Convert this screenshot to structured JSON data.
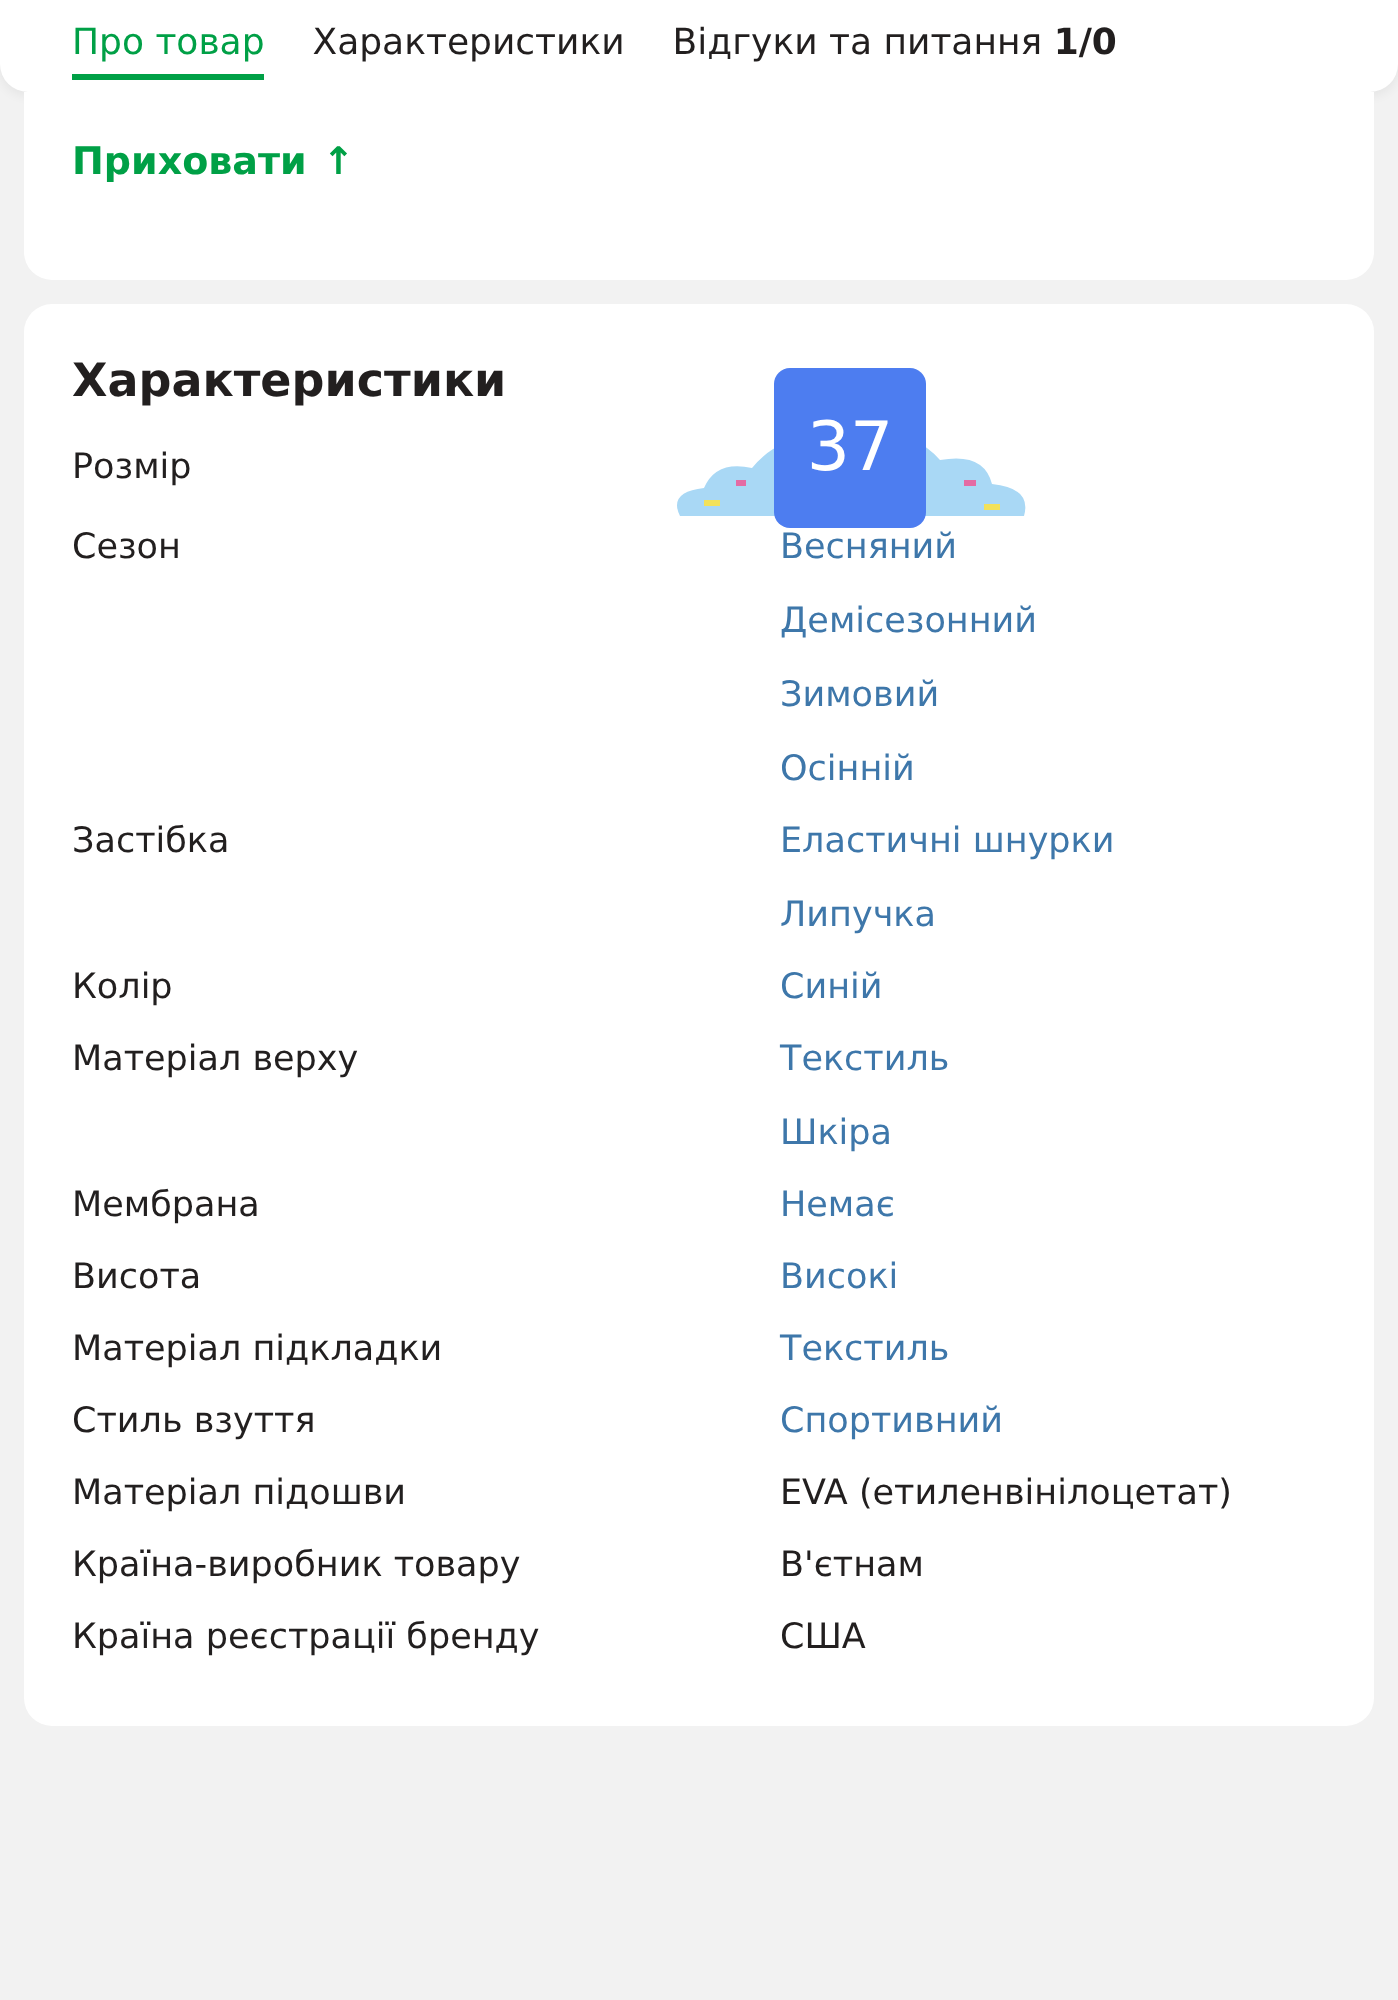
{
  "tabs": [
    {
      "label": "Про товар",
      "selected": true
    },
    {
      "label": "Характеристики",
      "selected": false
    },
    {
      "label": "Відгуки та питання",
      "count": "1/0",
      "selected": false
    }
  ],
  "hide_link": {
    "label": "Приховати",
    "icon": "↑"
  },
  "characteristics": {
    "title": "Характеристики",
    "rows": [
      {
        "label": "Розмір",
        "values": [
          {
            "text": "37",
            "kind": "badge"
          }
        ]
      },
      {
        "label": "Сезон",
        "values": [
          {
            "text": "Весняний",
            "kind": "link"
          },
          {
            "text": "Демісезонний",
            "kind": "link"
          },
          {
            "text": "Зимовий",
            "kind": "link"
          },
          {
            "text": "Осінній",
            "kind": "link"
          }
        ]
      },
      {
        "label": "Застібка",
        "values": [
          {
            "text": "Еластичні шнурки",
            "kind": "link"
          },
          {
            "text": "Липучка",
            "kind": "link"
          }
        ]
      },
      {
        "label": "Колір",
        "values": [
          {
            "text": "Синій",
            "kind": "link"
          }
        ]
      },
      {
        "label": "Матеріал верху",
        "values": [
          {
            "text": "Текстиль",
            "kind": "link"
          },
          {
            "text": "Шкіра",
            "kind": "link"
          }
        ]
      },
      {
        "label": "Мембрана",
        "values": [
          {
            "text": "Немає",
            "kind": "link"
          }
        ]
      },
      {
        "label": "Висота",
        "values": [
          {
            "text": "Високі",
            "kind": "link"
          }
        ]
      },
      {
        "label": "Матеріал підкладки",
        "values": [
          {
            "text": "Текстиль",
            "kind": "link"
          }
        ]
      },
      {
        "label": "Стиль взуття",
        "values": [
          {
            "text": "Спортивний",
            "kind": "link"
          }
        ]
      },
      {
        "label": "Матеріал підошви",
        "values": [
          {
            "text": "EVA (етиленвінілоцетат)",
            "kind": "text"
          }
        ]
      },
      {
        "label": "Країна-виробник товару",
        "values": [
          {
            "text": "В'єтнам",
            "kind": "text"
          }
        ]
      },
      {
        "label": "Країна реєстрації бренду",
        "values": [
          {
            "text": "США",
            "kind": "text"
          }
        ]
      }
    ]
  }
}
